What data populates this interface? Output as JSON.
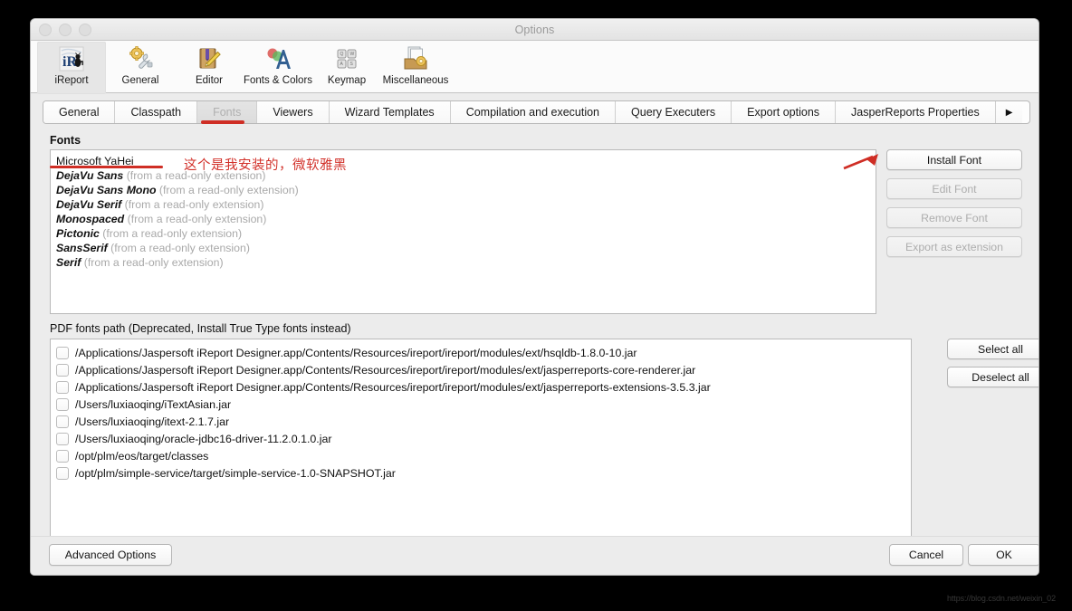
{
  "window": {
    "title": "Options",
    "traffic_lights": [
      "close",
      "minimize",
      "zoom"
    ]
  },
  "toolbar": {
    "items": [
      {
        "label": "iReport",
        "icon": "ireport-icon",
        "selected": true
      },
      {
        "label": "General",
        "icon": "gear-wrench-icon",
        "selected": false
      },
      {
        "label": "Editor",
        "icon": "book-pencil-icon",
        "selected": false
      },
      {
        "label": "Fonts & Colors",
        "icon": "fonts-colors-icon",
        "selected": false
      },
      {
        "label": "Keymap",
        "icon": "keyboard-keys-icon",
        "selected": false
      },
      {
        "label": "Miscellaneous",
        "icon": "folder-gear-icon",
        "selected": false
      }
    ]
  },
  "tabs": {
    "items": [
      {
        "label": "General",
        "active": false
      },
      {
        "label": "Classpath",
        "active": false
      },
      {
        "label": "Fonts",
        "active": true
      },
      {
        "label": "Viewers",
        "active": false
      },
      {
        "label": "Wizard Templates",
        "active": false
      },
      {
        "label": "Compilation and execution",
        "active": false
      },
      {
        "label": "Query Executers",
        "active": false
      },
      {
        "label": "Export options",
        "active": false
      },
      {
        "label": "JasperReports Properties",
        "active": false
      }
    ],
    "overflow_arrow": "▶"
  },
  "fonts_section": {
    "label": "Fonts",
    "rows": [
      {
        "name": "Microsoft YaHei",
        "note": "",
        "installed": true
      },
      {
        "name": "DejaVu Sans",
        "note": "(from a read-only extension)",
        "installed": false
      },
      {
        "name": "DejaVu Sans Mono",
        "note": "(from a read-only extension)",
        "installed": false
      },
      {
        "name": "DejaVu Serif",
        "note": "(from a read-only extension)",
        "installed": false
      },
      {
        "name": "Monospaced",
        "note": "(from a read-only extension)",
        "installed": false
      },
      {
        "name": "Pictonic",
        "note": "(from a read-only extension)",
        "installed": false
      },
      {
        "name": "SansSerif",
        "note": "(from a read-only extension)",
        "installed": false
      },
      {
        "name": "Serif",
        "note": "(from a read-only extension)",
        "installed": false
      }
    ],
    "buttons": [
      {
        "label": "Install Font",
        "enabled": true
      },
      {
        "label": "Edit Font",
        "enabled": false
      },
      {
        "label": "Remove Font",
        "enabled": false
      },
      {
        "label": "Export as extension",
        "enabled": false
      }
    ]
  },
  "pdf_section": {
    "label": "PDF fonts path (Deprecated, Install True Type fonts instead)",
    "paths": [
      {
        "path": "/Applications/Jaspersoft iReport Designer.app/Contents/Resources/ireport/ireport/modules/ext/hsqldb-1.8.0-10.jar",
        "checked": false
      },
      {
        "path": "/Applications/Jaspersoft iReport Designer.app/Contents/Resources/ireport/ireport/modules/ext/jasperreports-core-renderer.jar",
        "checked": false
      },
      {
        "path": "/Applications/Jaspersoft iReport Designer.app/Contents/Resources/ireport/ireport/modules/ext/jasperreports-extensions-3.5.3.jar",
        "checked": false
      },
      {
        "path": "/Users/luxiaoqing/iTextAsian.jar",
        "checked": false
      },
      {
        "path": "/Users/luxiaoqing/itext-2.1.7.jar",
        "checked": false
      },
      {
        "path": "/Users/luxiaoqing/oracle-jdbc16-driver-11.2.0.1.0.jar",
        "checked": false
      },
      {
        "path": "/opt/plm/eos/target/classes",
        "checked": false
      },
      {
        "path": "/opt/plm/simple-service/target/simple-service-1.0-SNAPSHOT.jar",
        "checked": false
      }
    ],
    "buttons": [
      {
        "label": "Select all"
      },
      {
        "label": "Deselect all"
      }
    ]
  },
  "footer": {
    "advanced_options": "Advanced Options",
    "cancel": "Cancel",
    "ok": "OK"
  },
  "annotations": {
    "note_text": "这个是我安装的，微软雅黑",
    "color": "#cf2e25"
  },
  "watermark": {
    "text": "https://blog.csdn.net/weixin_02"
  }
}
